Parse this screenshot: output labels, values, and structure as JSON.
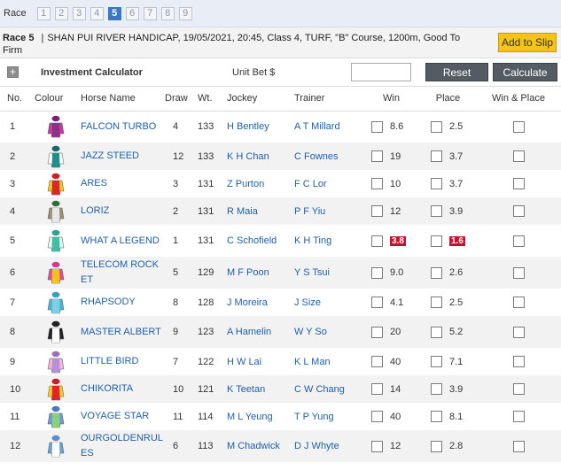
{
  "race_selector": {
    "label": "Race",
    "races": [
      "1",
      "2",
      "3",
      "4",
      "5",
      "6",
      "7",
      "8",
      "9"
    ],
    "active": "5"
  },
  "race_info": {
    "race_no": "Race 5",
    "description": "SHAN PUI RIVER HANDICAP, 19/05/2021, 20:45, Class 4, TURF, \"B\" Course, 1200m, Good To Firm",
    "add_to_slip": "Add to Slip"
  },
  "calculator": {
    "title": "Investment Calculator",
    "unit_bet_label": "Unit Bet $",
    "unit_bet_value": "",
    "reset_label": "Reset",
    "calculate_label": "Calculate"
  },
  "columns": {
    "no": "No.",
    "colour": "Colour",
    "horse": "Horse Name",
    "draw": "Draw",
    "wt": "Wt.",
    "jockey": "Jockey",
    "trainer": "Trainer",
    "win": "Win",
    "place": "Place",
    "win_place": "Win & Place"
  },
  "runners": [
    {
      "no": "1",
      "horse": "FALCON TURBO",
      "draw": "4",
      "wt": "133",
      "jockey": "H Bentley",
      "trainer": "A T Millard",
      "win": "8.6",
      "place": "2.5",
      "silk": {
        "body": "#8e2f8a",
        "sleeve": "#c53d9c",
        "cap": "#7a1f7a"
      }
    },
    {
      "no": "2",
      "horse": "JAZZ STEED",
      "draw": "12",
      "wt": "133",
      "jockey": "K H Chan",
      "trainer": "C Fownes",
      "win": "19",
      "place": "3.7",
      "silk": {
        "body": "#1e8f8a",
        "sleeve": "#ffffff",
        "cap": "#126b67"
      }
    },
    {
      "no": "3",
      "horse": "ARES",
      "draw": "3",
      "wt": "131",
      "jockey": "Z Purton",
      "trainer": "F C Lor",
      "win": "10",
      "place": "3.7",
      "silk": {
        "body": "#d9262b",
        "sleeve": "#f2c62a",
        "cap": "#c91f24"
      }
    },
    {
      "no": "4",
      "horse": "LORIZ",
      "draw": "2",
      "wt": "131",
      "jockey": "R Maia",
      "trainer": "P F Yiu",
      "win": "12",
      "place": "3.9",
      "silk": {
        "body": "#e7e7e7",
        "sleeve": "#9a8f70",
        "cap": "#2f6e3a"
      }
    },
    {
      "no": "5",
      "horse": "WHAT A LEGEND",
      "draw": "1",
      "wt": "131",
      "jockey": "C Schofield",
      "trainer": "K H Ting",
      "win": "3.8",
      "place": "1.6",
      "hot": true,
      "silk": {
        "body": "#3cc1a6",
        "sleeve": "#e8f3ef",
        "cap": "#2fa58c"
      }
    },
    {
      "no": "6",
      "horse": "TELECOM ROCKET",
      "draw": "5",
      "wt": "129",
      "jockey": "M F Poon",
      "trainer": "Y S Tsui",
      "win": "9.0",
      "place": "2.6",
      "silk": {
        "body": "#f0c419",
        "sleeve": "#e64a9a",
        "cap": "#d23a8a"
      }
    },
    {
      "no": "7",
      "horse": "RHAPSODY",
      "draw": "8",
      "wt": "128",
      "jockey": "J Moreira",
      "trainer": "J Size",
      "win": "4.1",
      "place": "2.5",
      "silk": {
        "body": "#7fd0e6",
        "sleeve": "#4fb5cf",
        "cap": "#3a9fbb"
      }
    },
    {
      "no": "8",
      "horse": "MASTER ALBERT",
      "draw": "9",
      "wt": "123",
      "jockey": "A Hamelin",
      "trainer": "W Y So",
      "win": "20",
      "place": "5.2",
      "silk": {
        "body": "#ffffff",
        "sleeve": "#222222",
        "cap": "#222222"
      }
    },
    {
      "no": "9",
      "horse": "LITTLE BIRD",
      "draw": "7",
      "wt": "122",
      "jockey": "H W Lai",
      "trainer": "K L Man",
      "win": "40",
      "place": "7.1",
      "silk": {
        "body": "#b78fd6",
        "sleeve": "#f2b3d9",
        "cap": "#9a6fc0"
      }
    },
    {
      "no": "10",
      "horse": "CHIKORITA",
      "draw": "10",
      "wt": "121",
      "jockey": "K Teetan",
      "trainer": "C W Chang",
      "win": "14",
      "place": "3.9",
      "silk": {
        "body": "#e0242a",
        "sleeve": "#f4d21e",
        "cap": "#c81e24"
      }
    },
    {
      "no": "11",
      "horse": "VOYAGE STAR",
      "draw": "11",
      "wt": "114",
      "jockey": "M L Yeung",
      "trainer": "T P Yung",
      "win": "40",
      "place": "8.1",
      "silk": {
        "body": "#8ad07a",
        "sleeve": "#6f9ad8",
        "cap": "#4d78c0"
      }
    },
    {
      "no": "12",
      "horse": "OURGOLDENRULES",
      "draw": "6",
      "wt": "113",
      "jockey": "M Chadwick",
      "trainer": "D J Whyte",
      "win": "12",
      "place": "2.8",
      "silk": {
        "body": "#ffffff",
        "sleeve": "#6aa0d6",
        "cap": "#5a8fc8"
      }
    }
  ]
}
